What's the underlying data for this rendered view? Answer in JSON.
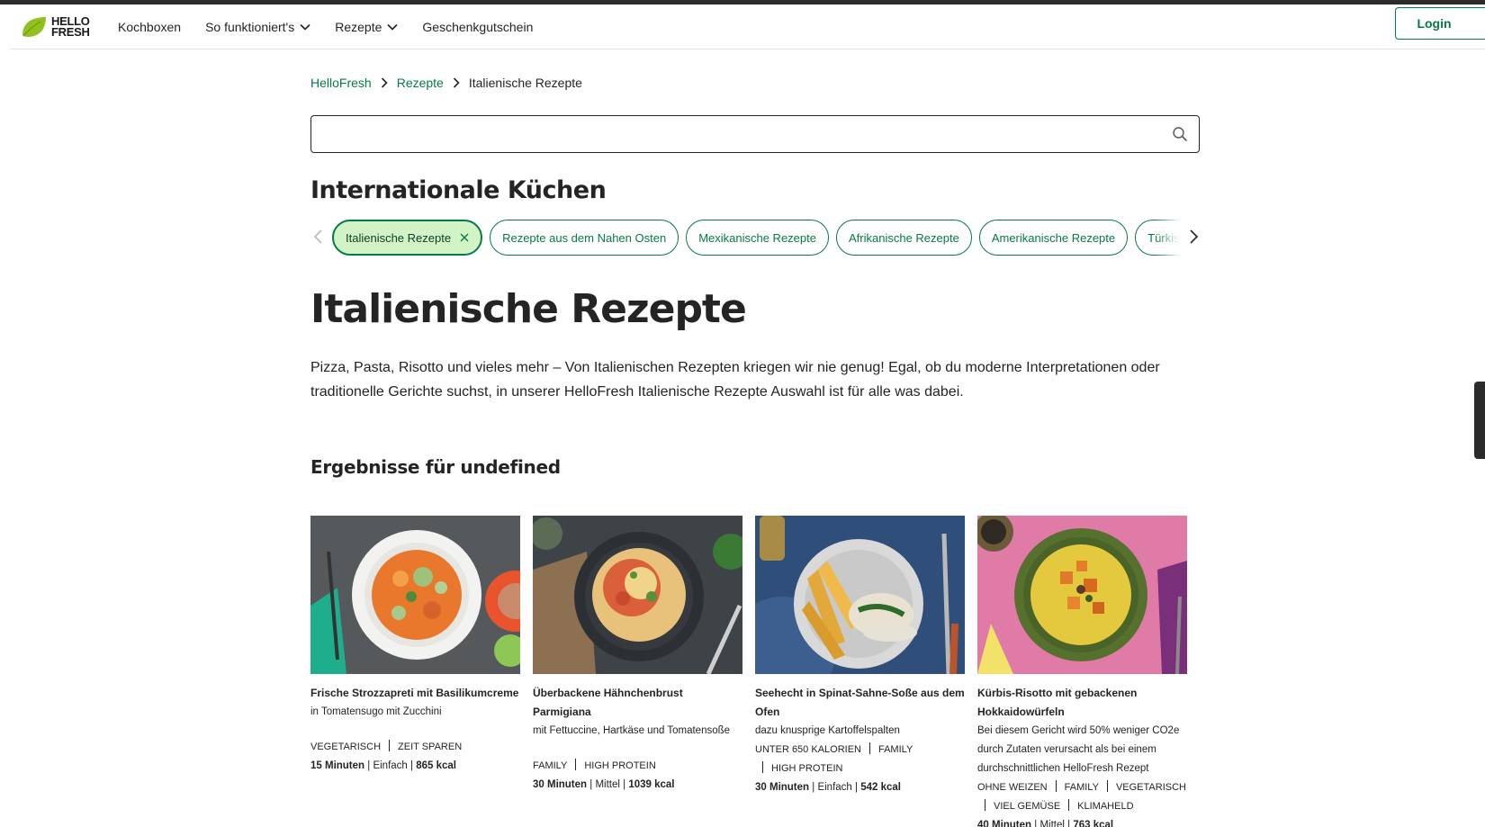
{
  "brand": {
    "logo_line1": "HELLO",
    "logo_line2": "FRESH",
    "leaf_color": "#91c11e",
    "accent_color": "#067a46"
  },
  "nav": {
    "items": [
      {
        "label": "Kochboxen",
        "dropdown": false
      },
      {
        "label": "So funktioniert's",
        "dropdown": true
      },
      {
        "label": "Rezepte",
        "dropdown": true
      },
      {
        "label": "Geschenkgutschein",
        "dropdown": false
      }
    ],
    "login_label": "Login"
  },
  "breadcrumb": {
    "items": [
      "HelloFresh",
      "Rezepte"
    ],
    "current": "Italienische Rezepte"
  },
  "search": {
    "value": "",
    "placeholder": ""
  },
  "cuisines": {
    "title": "Internationale Küchen",
    "chips": [
      {
        "label": "Italienische Rezepte",
        "active": true
      },
      {
        "label": "Rezepte aus dem Nahen Osten",
        "active": false
      },
      {
        "label": "Mexikanische Rezepte",
        "active": false
      },
      {
        "label": "Afrikanische Rezepte",
        "active": false
      },
      {
        "label": "Amerikanische Rezepte",
        "active": false
      },
      {
        "label": "Türkische Rezepte",
        "active": false
      }
    ]
  },
  "page": {
    "title": "Italienische Rezepte",
    "intro": "Pizza, Pasta, Risotto und vieles mehr – Von Italienischen Rezepten kriegen wir nie genug! Egal, ob du moderne Interpretationen oder traditionelle Gerichte suchst, in unserer HelloFresh Italienische Rezepte Auswahl ist für alle was dabei.",
    "results_title": "Ergebnisse für undefined"
  },
  "recipes": [
    {
      "title": "Frische Strozzapreti mit Basilikumcreme",
      "subtitle": "in Tomatensugo mit Zucchini",
      "tags_line1": [
        "VEGETARISCH",
        "ZEIT SPAREN"
      ],
      "tags_line2": [],
      "time": "15 Minuten",
      "difficulty": "Einfach",
      "kcal": "865 kcal"
    },
    {
      "title": "Überbackene Hähnchenbrust Parmigiana",
      "subtitle": "mit Fettuccine, Hartkäse und Tomatensoße",
      "tags_line1": [
        "FAMILY",
        "HIGH PROTEIN"
      ],
      "tags_line2": [],
      "time": "30 Minuten",
      "difficulty": "Mittel",
      "kcal": "1039 kcal"
    },
    {
      "title": "Seehecht in Spinat-Sahne-Soße aus dem Ofen",
      "subtitle": "dazu knusprige Kartoffelspalten",
      "tags_line1": [
        "UNTER 650 KALORIEN",
        "FAMILY"
      ],
      "tags_line2": [
        "HIGH PROTEIN"
      ],
      "time": "30 Minuten",
      "difficulty": "Einfach",
      "kcal": "542 kcal"
    },
    {
      "title": "Kürbis-Risotto mit gebackenen Hokkaidowürfeln",
      "subtitle": "Bei diesem Gericht wird 50% weniger CO2e durch Zutaten verursacht als bei einem durchschnittlichen HelloFresh Rezept",
      "tags_line1": [
        "OHNE WEIZEN",
        "FAMILY",
        "VEGETARISCH"
      ],
      "tags_line2": [
        "VIEL GEMÜSE",
        "KLIMAHELD"
      ],
      "time": "40 Minuten",
      "difficulty": "Mittel",
      "kcal": "763 kcal"
    }
  ]
}
